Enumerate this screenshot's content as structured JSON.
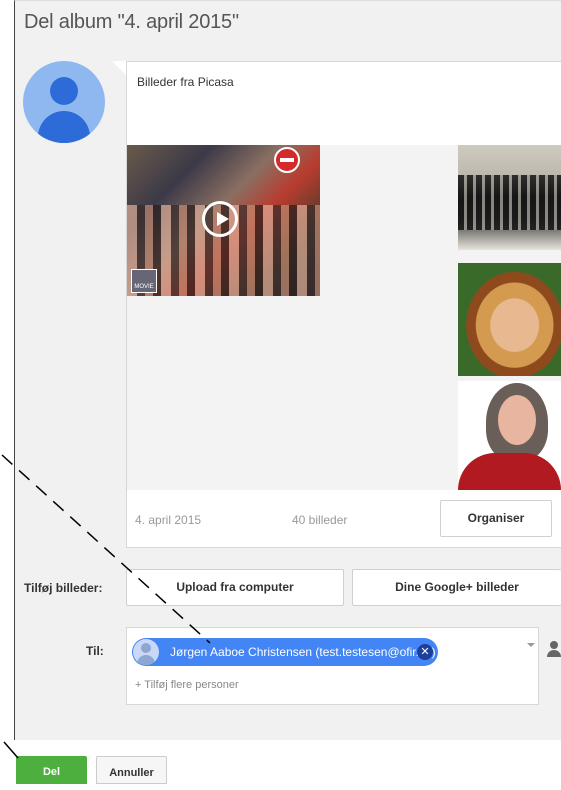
{
  "dialog": {
    "title": "Del album \"4. april 2015\""
  },
  "post": {
    "caption": "Billeder fra Picasa",
    "photos": [
      {
        "name": "video-crowd-thumbnail",
        "movie_label": "MOVIE"
      },
      {
        "name": "group-photo-thumbnail"
      },
      {
        "name": "blonde-woman-thumbnail"
      },
      {
        "name": "gray-haired-woman-thumbnail"
      }
    ],
    "date": "4. april 2015",
    "count": "40 billeder",
    "organise_label": "Organiser"
  },
  "add_photos": {
    "label": "Tilføj billeder:",
    "upload_label": "Upload fra computer",
    "google_label": "Dine Google+ billeder"
  },
  "recipients": {
    "label": "Til:",
    "chip_text": "Jørgen Aaboe Christensen (test.testesen@ofir.dk)",
    "remove_icon": "✕",
    "add_more_placeholder": "+ Tilføj flere personer"
  },
  "actions": {
    "share_label": "Del",
    "cancel_label": "Annuller"
  },
  "colors": {
    "accent_blue": "#4385f5",
    "share_green": "#4caf3e",
    "avatar_blue": "#90b8f0"
  }
}
